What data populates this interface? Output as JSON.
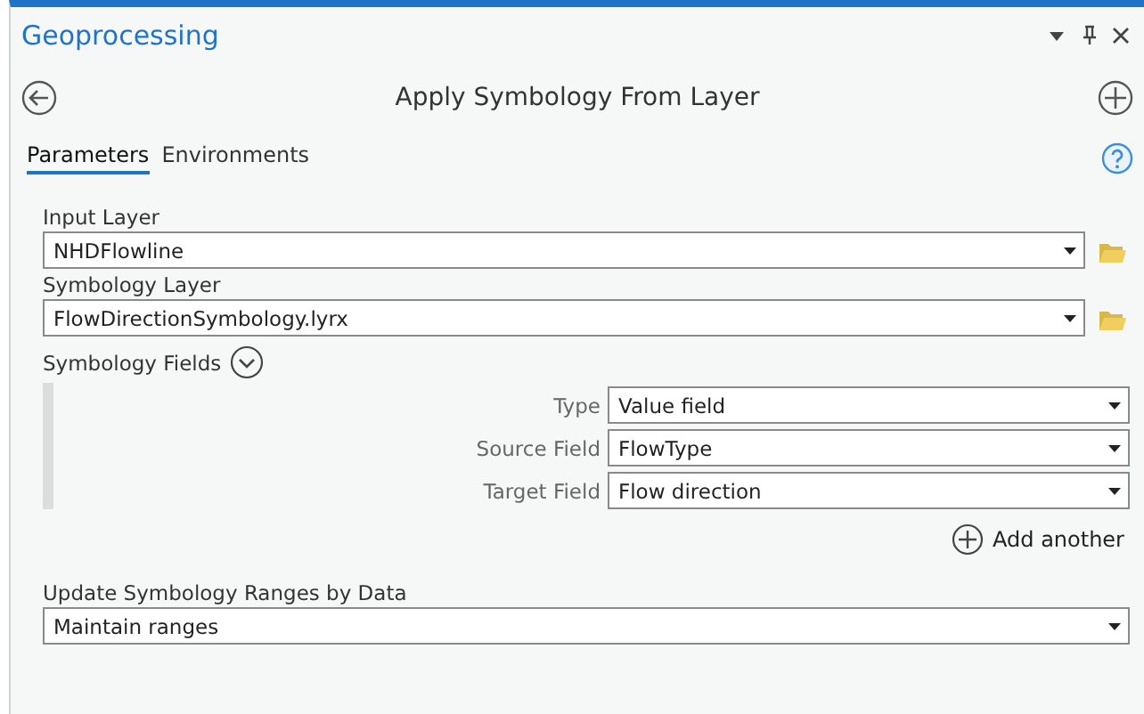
{
  "pane": {
    "title": "Geoprocessing"
  },
  "tool": {
    "title": "Apply Symbology From Layer"
  },
  "tabs": [
    {
      "label": "Parameters",
      "selected": true
    },
    {
      "label": "Environments",
      "selected": false
    }
  ],
  "parameters": [
    {
      "label": "Input Layer",
      "value": "NHDFlowline",
      "browse": true
    },
    {
      "label": "Symbology Layer",
      "value": "FlowDirectionSymbology.lyrx",
      "browse": true
    }
  ],
  "symbology_fields": {
    "label": "Symbology Fields",
    "expanded": true,
    "rows": [
      {
        "label": "Type",
        "value": "Value field"
      },
      {
        "label": "Source Field",
        "value": "FlowType"
      },
      {
        "label": "Target Field",
        "value": "Flow direction"
      }
    ],
    "add_label": "Add another"
  },
  "update_ranges": {
    "label": "Update Symbology Ranges by Data",
    "value": "Maintain ranges"
  }
}
